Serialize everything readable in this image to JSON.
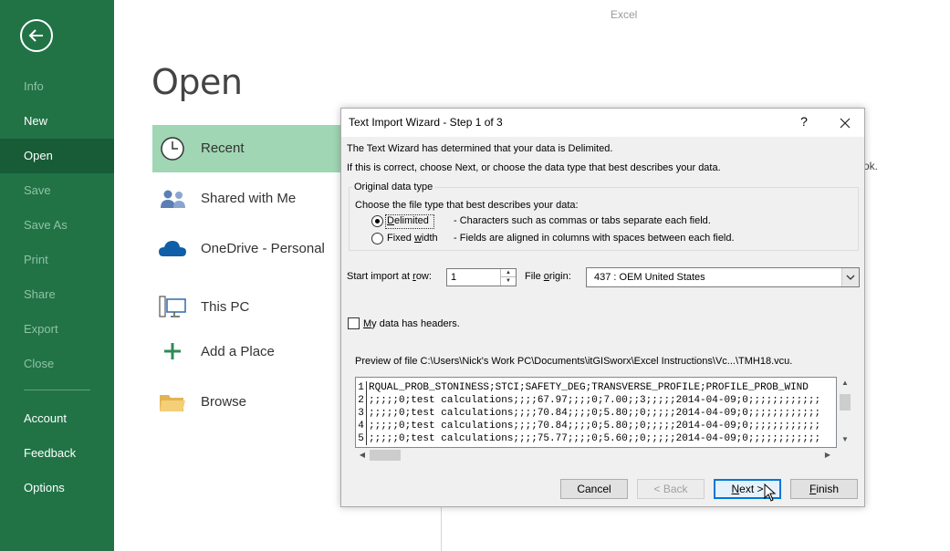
{
  "app": {
    "title": "Excel"
  },
  "sidebar": {
    "items": [
      {
        "label": "Info",
        "state": "disabled"
      },
      {
        "label": "New",
        "state": "enabled"
      },
      {
        "label": "Open",
        "state": "selected"
      },
      {
        "label": "Save",
        "state": "disabled"
      },
      {
        "label": "Save As",
        "state": "disabled"
      },
      {
        "label": "Print",
        "state": "disabled"
      },
      {
        "label": "Share",
        "state": "disabled"
      },
      {
        "label": "Export",
        "state": "disabled"
      },
      {
        "label": "Close",
        "state": "disabled"
      },
      {
        "label": "Account",
        "state": "enabled"
      },
      {
        "label": "Feedback",
        "state": "enabled"
      },
      {
        "label": "Options",
        "state": "enabled"
      }
    ]
  },
  "backstage": {
    "heading": "Open",
    "locations": [
      {
        "label": "Recent",
        "icon": "clock-icon",
        "selected": true
      },
      {
        "label": "Shared with Me",
        "icon": "people-icon"
      },
      {
        "label": "OneDrive - Personal",
        "icon": "cloud-icon"
      },
      {
        "label": "This PC",
        "icon": "computer-icon"
      },
      {
        "label": "Add a Place",
        "icon": "plus-icon"
      },
      {
        "label": "Browse",
        "icon": "folder-icon"
      }
    ],
    "right_fragment": "ok."
  },
  "dialog": {
    "title": "Text Import Wizard - Step 1 of 3",
    "help": "?",
    "intro1": "The Text Wizard has determined that your data is Delimited.",
    "intro2": "If this is correct, choose Next, or choose the data type that best describes your data.",
    "group_legend": "Original data type",
    "group_prompt": "Choose the file type that best describes your data:",
    "radio_delimited": {
      "label_pre": "",
      "label_u": "D",
      "label_post": "elimited",
      "desc": "- Characters such as commas or tabs separate each field.",
      "checked": true
    },
    "radio_fixed": {
      "label_pre": "Fixed ",
      "label_u": "w",
      "label_post": "idth",
      "desc": "- Fields are aligned in columns with spaces between each field.",
      "checked": false
    },
    "start_row": {
      "label_pre": "Start import at ",
      "label_u": "r",
      "label_post": "ow:",
      "value": "1"
    },
    "file_origin": {
      "label_pre": "File ",
      "label_u": "o",
      "label_post": "rigin:",
      "value": "437 : OEM United States"
    },
    "headers": {
      "label_pre": "",
      "label_u": "M",
      "label_post": "y data has headers.",
      "checked": false
    },
    "preview_label": "Preview of file C:\\Users\\Nick's Work PC\\Documents\\itGISworx\\Excel Instructions\\Vc...\\TMH18.vcu.",
    "preview_rows": [
      {
        "num": "1",
        "text": "RQUAL_PROB_STONINESS;STCI;SAFETY_DEG;TRANSVERSE_PROFILE;PROFILE_PROB_WIND"
      },
      {
        "num": "2",
        "text": ";;;;;0;test calculations;;;;67.97;;;;0;7.00;;3;;;;;2014-04-09;0;;;;;;;;;;;;"
      },
      {
        "num": "3",
        "text": ";;;;;0;test calculations;;;;70.84;;;;0;5.80;;0;;;;;2014-04-09;0;;;;;;;;;;;;"
      },
      {
        "num": "4",
        "text": ";;;;;0;test calculations;;;;70.84;;;;0;5.80;;0;;;;;2014-04-09;0;;;;;;;;;;;;"
      },
      {
        "num": "5",
        "text": ";;;;;0;test calculations;;;;75.77;;;;0;5.60;;0;;;;;2014-04-09;0;;;;;;;;;;;;"
      }
    ],
    "buttons": {
      "cancel": "Cancel",
      "back": "< Back",
      "next_u": "N",
      "next_post": "ext >",
      "finish_u": "F",
      "finish_post": "inish"
    }
  },
  "colors": {
    "sidebar_bg": "#217346",
    "sidebar_selected": "#185c37",
    "recent_selected": "#a0d6b4",
    "dialog_bg": "#f0f0f0"
  }
}
